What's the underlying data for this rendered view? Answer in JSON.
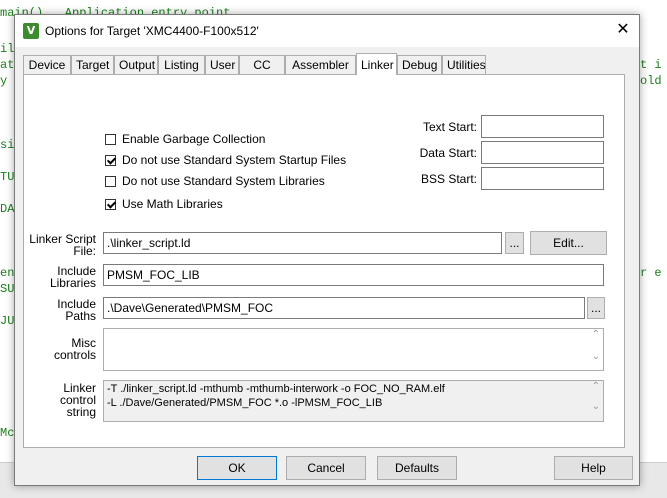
{
  "background_editor": {
    "lines": [
      "main()   Application entry point",
      "ils",
      "ati",
      "y t",
      "sic",
      "TUS",
      "DA",
      "",
      "ent",
      "SUC",
      "JU)",
      "Mc"
    ],
    "right_fragments": [
      "t i",
      "old",
      "r e"
    ]
  },
  "dialog": {
    "title": "Options for Target 'XMC4400-F100x512'",
    "close_glyph": "✕",
    "icon_glyph": "V"
  },
  "tabs": [
    {
      "label": "Device",
      "active": false
    },
    {
      "label": "Target",
      "active": false
    },
    {
      "label": "Output",
      "active": false
    },
    {
      "label": "Listing",
      "active": false
    },
    {
      "label": "User",
      "active": false
    },
    {
      "label": "CC",
      "active": false
    },
    {
      "label": "Assembler",
      "active": false
    },
    {
      "label": "Linker",
      "active": true
    },
    {
      "label": "Debug",
      "active": false
    },
    {
      "label": "Utilities",
      "active": false
    }
  ],
  "linker": {
    "options": [
      {
        "label": "Enable Garbage Collection",
        "checked": false
      },
      {
        "label": "Do not use Standard System Startup Files",
        "checked": true
      },
      {
        "label": "Do not use Standard System Libraries",
        "checked": false
      },
      {
        "label": "Use Math Libraries",
        "checked": true
      }
    ],
    "text_start_label": "Text Start:",
    "text_start_value": "",
    "data_start_label": "Data Start:",
    "data_start_value": "",
    "bss_start_label": "BSS Start:",
    "bss_start_value": "",
    "script_label_1": "Linker Script",
    "script_label_2": "File:",
    "script_value": ".\\linker_script.ld",
    "browse_label": "...",
    "edit_label": "Edit...",
    "include_libs_label_1": "Include",
    "include_libs_label_2": "Libraries",
    "include_libs_value": "PMSM_FOC_LIB",
    "include_paths_label_1": "Include",
    "include_paths_label_2": "Paths",
    "include_paths_value": ".\\Dave\\Generated\\PMSM_FOC",
    "paths_browse_label": "...",
    "misc_label_1": "Misc",
    "misc_label_2": "controls",
    "misc_value": "",
    "control_label_1": "Linker",
    "control_label_2": "control",
    "control_label_3": "string",
    "control_line_1": "-T ./linker_script.ld -mthumb -mthumb-interwork -o FOC_NO_RAM.elf",
    "control_line_2": "-L ./Dave/Generated/PMSM_FOC *.o -lPMSM_FOC_LIB"
  },
  "footer": {
    "ok": "OK",
    "cancel": "Cancel",
    "defaults": "Defaults",
    "help": "Help"
  },
  "scroll_glyphs": {
    "up": "⌃",
    "down": "⌄"
  }
}
